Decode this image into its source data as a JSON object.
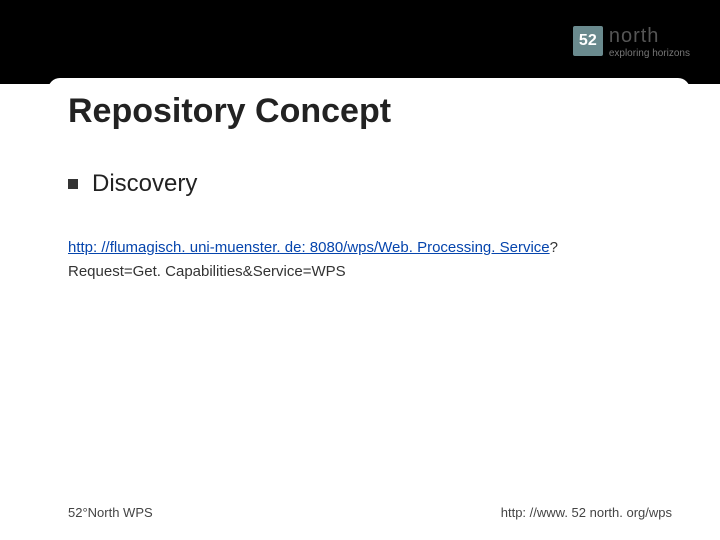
{
  "logo": {
    "square": "52",
    "main": "north",
    "sub": "exploring horizons"
  },
  "title": "Repository Concept",
  "bullet": "Discovery",
  "url": {
    "link": "http: //flumagisch. uni-muenster. de: 8080/wps/Web. Processing. Service",
    "q": "?",
    "line2": "Request=Get. Capabilities&Service=WPS"
  },
  "footer": {
    "left": "52°North WPS",
    "right": "http: //www. 52 north. org/wps"
  }
}
